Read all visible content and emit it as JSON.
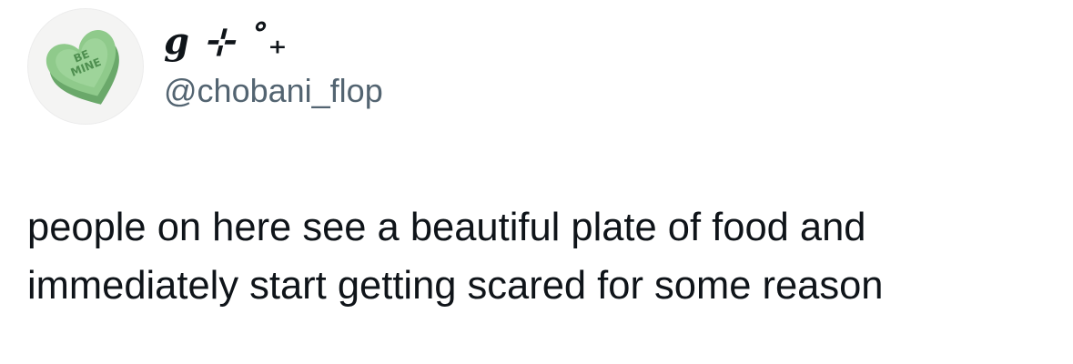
{
  "author": {
    "display_name": "g ⊹ ˚₊",
    "handle": "@chobani_flop",
    "avatar": {
      "icon": "candy-heart-icon",
      "text_line1": "BE",
      "text_line2": "MINE",
      "color": "#7fbf7f",
      "background": "#f4f4f3"
    }
  },
  "tweet": {
    "text": "people on here see a beautiful plate of food and\nimmediately start getting scared for some reason"
  },
  "colors": {
    "text_primary": "#0f1419",
    "text_secondary": "#536471",
    "background": "#ffffff"
  }
}
